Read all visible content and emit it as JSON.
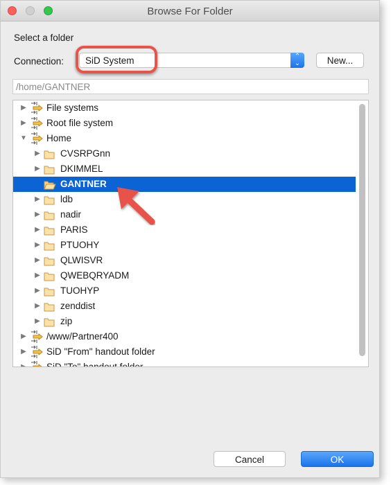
{
  "window": {
    "title": "Browse For Folder"
  },
  "prompt": "Select a folder",
  "connection": {
    "label": "Connection:",
    "value": "SiD System",
    "new_button": "New..."
  },
  "path": "/home/GANTNER",
  "tree": [
    {
      "label": "File systems",
      "level": 0,
      "type": "connection",
      "state": "collapsed"
    },
    {
      "label": "Root file system",
      "level": 0,
      "type": "connection",
      "state": "collapsed"
    },
    {
      "label": "Home",
      "level": 0,
      "type": "connection",
      "state": "expanded"
    },
    {
      "label": "CVSRPGnn",
      "level": 1,
      "type": "folder",
      "state": "collapsed"
    },
    {
      "label": "DKIMMEL",
      "level": 1,
      "type": "folder",
      "state": "collapsed"
    },
    {
      "label": "GANTNER",
      "level": 1,
      "type": "folder-open",
      "state": "leaf",
      "selected": true
    },
    {
      "label": "ldb",
      "level": 1,
      "type": "folder",
      "state": "collapsed"
    },
    {
      "label": "nadir",
      "level": 1,
      "type": "folder",
      "state": "collapsed"
    },
    {
      "label": "PARIS",
      "level": 1,
      "type": "folder",
      "state": "collapsed"
    },
    {
      "label": "PTUOHY",
      "level": 1,
      "type": "folder",
      "state": "collapsed"
    },
    {
      "label": "QLWISVR",
      "level": 1,
      "type": "folder",
      "state": "collapsed"
    },
    {
      "label": "QWEBQRYADM",
      "level": 1,
      "type": "folder",
      "state": "collapsed"
    },
    {
      "label": "TUOHYP",
      "level": 1,
      "type": "folder",
      "state": "collapsed"
    },
    {
      "label": "zenddist",
      "level": 1,
      "type": "folder",
      "state": "collapsed"
    },
    {
      "label": "zip",
      "level": 1,
      "type": "folder",
      "state": "collapsed"
    },
    {
      "label": "/www/Partner400",
      "level": 0,
      "type": "connection",
      "state": "collapsed"
    },
    {
      "label": "SiD \"From\" handout folder",
      "level": 0,
      "type": "connection",
      "state": "collapsed"
    },
    {
      "label": "SiD \"To\" handout folder",
      "level": 0,
      "type": "connection",
      "state": "collapsed"
    }
  ],
  "buttons": {
    "cancel": "Cancel",
    "ok": "OK"
  },
  "colors": {
    "selection": "#0c63d4",
    "annotation": "#e8534a",
    "ok": "#1a7cf0"
  }
}
